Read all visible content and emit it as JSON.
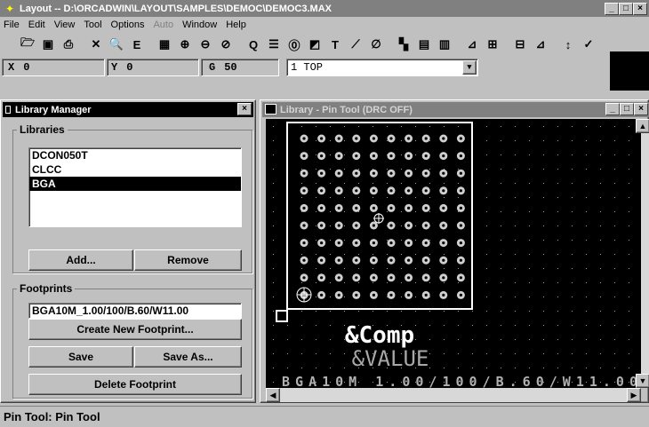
{
  "window": {
    "title": "Layout -- D:\\ORCADWIN\\LAYOUT\\SAMPLES\\DEMOC\\DEMOC3.MAX",
    "buttons": [
      "_",
      "□",
      "×"
    ]
  },
  "menu": {
    "file": "File",
    "edit": "Edit",
    "view": "View",
    "tool": "Tool",
    "options": "Options",
    "auto": "Auto",
    "window": "Window",
    "help": "Help"
  },
  "toolbar": {
    "icons": [
      "open-icon",
      "save-icon",
      "print-icon",
      "delete-icon",
      "find-icon",
      "edit-icon",
      "spreadsheet-icon",
      "zoom-in-icon",
      "zoom-out-icon",
      "zoom-all-icon",
      "query-icon",
      "component-icon",
      "pin-icon",
      "obstacle-icon",
      "text-icon",
      "connection-icon",
      "error-icon",
      "reconnect-icon",
      "autoroute-icon",
      "online-drc-icon",
      "reports-icon",
      "post-process-icon",
      "library-icon",
      "footprint-icon",
      "refresh-icon"
    ]
  },
  "coords": {
    "x_label": "X",
    "x_value": "0",
    "y_label": "Y",
    "y_value": "0",
    "g_label": "G",
    "g_value": "50",
    "layer": "1 TOP"
  },
  "library_manager": {
    "title": "Library Manager",
    "libraries_label": "Libraries",
    "libraries": [
      "DCON050T",
      "CLCC",
      "BGA"
    ],
    "selected_library": "BGA",
    "add_label": "Add...",
    "remove_label": "Remove",
    "footprints_label": "Footprints",
    "footprint_value": "BGA10M_1.00/100/B.60/W11.00",
    "create_label": "Create New Footprint...",
    "save_label": "Save",
    "save_as_label": "Save As...",
    "delete_label": "Delete Footprint"
  },
  "pin_window": {
    "title": "Library - Pin Tool (DRC OFF)",
    "comp_text": "&Comp",
    "value_text": "&VALUE",
    "footprint_text": "BGA10M_1.00/100/B.60/W11.00",
    "grid": {
      "rows": 10,
      "cols": 10
    }
  },
  "colors": {
    "canvas": "#000000",
    "outline": "#ffffff",
    "pad": "#cfcfcf",
    "dots": "#9a9a9a",
    "value_text": "#a8a8a8"
  },
  "status": {
    "text": "Pin Tool: Pin Tool"
  }
}
